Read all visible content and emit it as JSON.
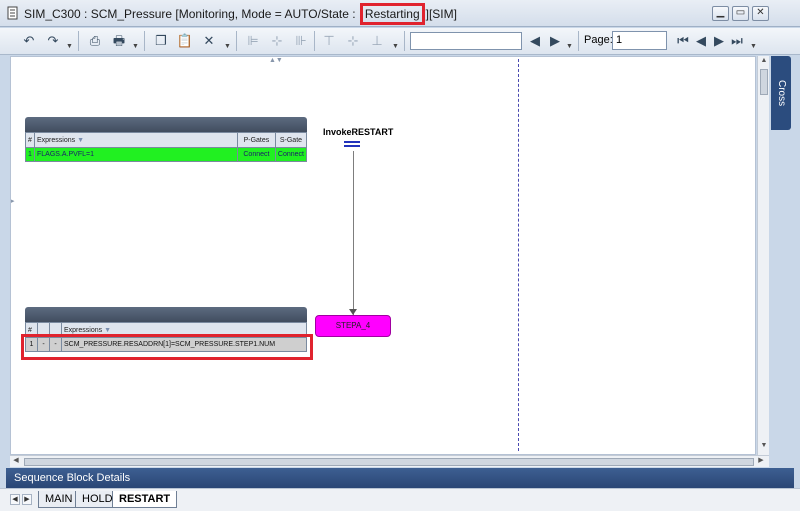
{
  "window": {
    "title_pre": "SIM_C300 : SCM_Pressure [Monitoring, Mode  = AUTO/State : ",
    "title_state": "Restarting",
    "title_post": "][SIM]"
  },
  "toolbar": {
    "page_label": "Page:",
    "page_value": "1"
  },
  "side_panel": {
    "label": "Cross References"
  },
  "diagram": {
    "top_table": {
      "headers": [
        "#",
        "Expressions",
        "P-Gates",
        "S-Gate"
      ],
      "row": [
        "1",
        "FLAGS.A.PVFL=1",
        "Connect",
        "Connect"
      ]
    },
    "invoke_label": "InvokeRESTART",
    "step_label": "STEPA_4",
    "bottom_table": {
      "headers": [
        "#",
        "",
        "",
        "Expressions"
      ],
      "row": [
        "1",
        "-",
        "-",
        "SCM_PRESSURE.RESADDRN[1]=SCM_PRESSURE.STEP1.NUM"
      ]
    }
  },
  "details_bar": {
    "label": "Sequence Block Details"
  },
  "tabs": [
    "MAIN",
    "HOLD",
    "RESTART"
  ],
  "colors": {
    "highlight": "#e0232e",
    "step_fill": "#ff00ff",
    "true_row": "#21f021",
    "header_dark": "#3f4b5d"
  }
}
